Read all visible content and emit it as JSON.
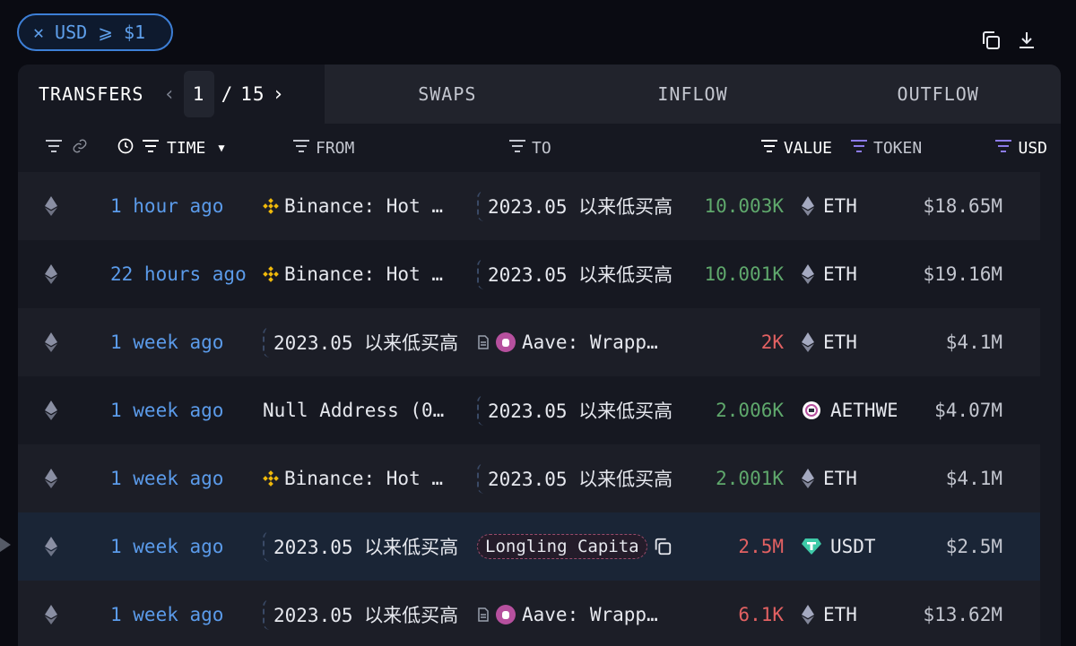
{
  "filter": {
    "label": "USD ⩾ $1",
    "close_icon": "close-icon"
  },
  "top_icons": [
    "copy-icon",
    "download-icon"
  ],
  "tabs": {
    "transfers": "TRANSFERS",
    "page_current": "1",
    "page_sep": "/",
    "page_total": "15",
    "swaps": "SWAPS",
    "inflow": "INFLOW",
    "outflow": "OUTFLOW"
  },
  "columns": {
    "time": "TIME",
    "from": "FROM",
    "to": "TO",
    "value": "VALUE",
    "token": "TOKEN",
    "usd": "USD"
  },
  "rows": [
    {
      "time": "1 hour ago",
      "from": "Binance: Hot …",
      "from_icon": "binance-icon",
      "to": "2023.05 以来低买高",
      "value": "10.003K",
      "value_color": "green",
      "token": "ETH",
      "token_icon": "eth-icon",
      "usd": "$18.65M"
    },
    {
      "time": "22 hours ago",
      "from": "Binance: Hot …",
      "from_icon": "binance-icon",
      "to": "2023.05 以来低买高",
      "value": "10.001K",
      "value_color": "green",
      "token": "ETH",
      "token_icon": "eth-icon",
      "usd": "$19.16M"
    },
    {
      "time": "1 week ago",
      "from": "2023.05 以来低买高",
      "to": "Aave: Wrapp…",
      "to_icon": "aave-icon",
      "value": "2K",
      "value_color": "red",
      "token": "ETH",
      "token_icon": "eth-icon",
      "usd": "$4.1M"
    },
    {
      "time": "1 week ago",
      "from": "Null Address (0…",
      "to": "2023.05 以来低买高",
      "value": "2.006K",
      "value_color": "green",
      "token": "AETHWE",
      "token_icon": "aethweth-icon",
      "usd": "$4.07M"
    },
    {
      "time": "1 week ago",
      "from": "Binance: Hot …",
      "from_icon": "binance-icon",
      "to": "2023.05 以来低买高",
      "value": "2.001K",
      "value_color": "green",
      "token": "ETH",
      "token_icon": "eth-icon",
      "usd": "$4.1M"
    },
    {
      "time": "1 week ago",
      "from": "2023.05 以来低买高",
      "to": "Longling Capita",
      "to_icon": "copy-icon",
      "value": "2.5M",
      "value_color": "red",
      "token": "USDT",
      "token_icon": "usdt-icon",
      "usd": "$2.5M"
    },
    {
      "time": "1 week ago",
      "from": "2023.05 以来低买高",
      "to": "Aave: Wrapp…",
      "to_icon": "aave-icon",
      "value": "6.1K",
      "value_color": "red",
      "token": "ETH",
      "token_icon": "eth-icon",
      "usd": "$13.62M"
    }
  ],
  "colors": {
    "accent": "#5b9bea",
    "green": "#5fa86c",
    "red": "#e26162"
  }
}
